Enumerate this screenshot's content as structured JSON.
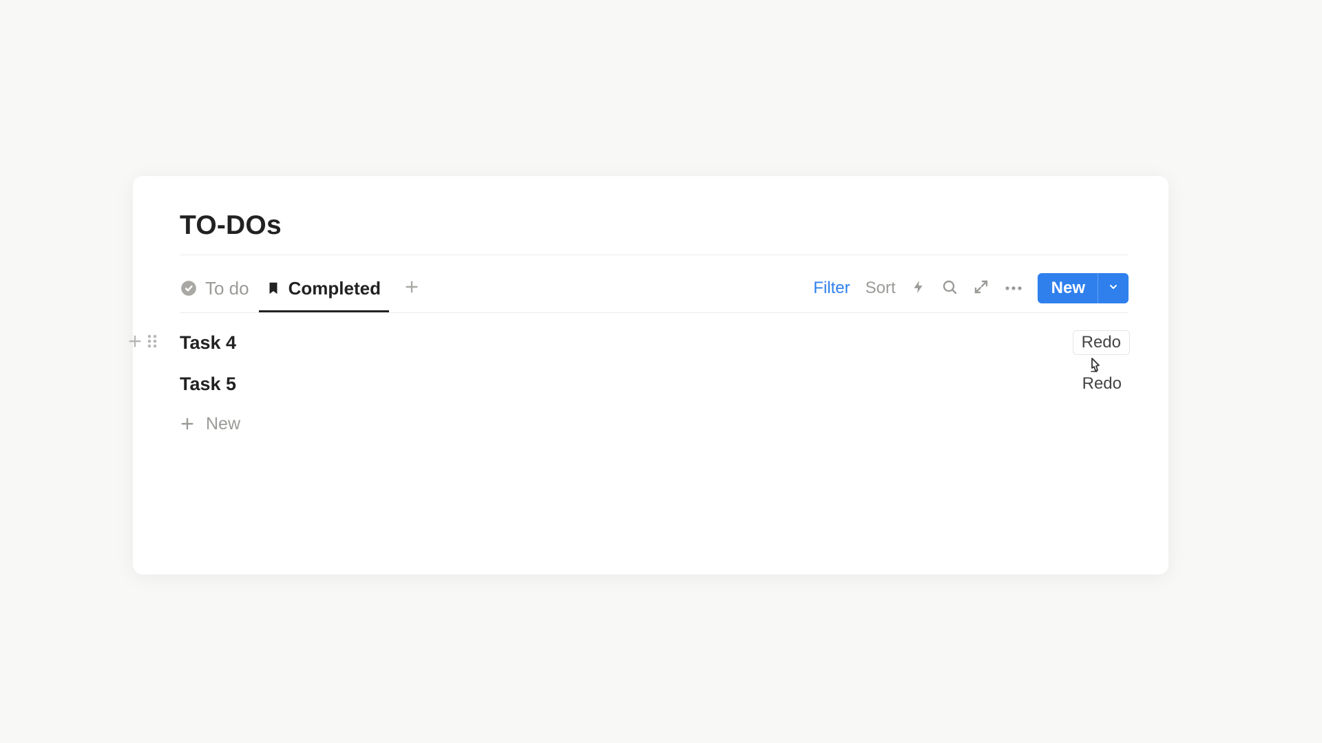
{
  "header": {
    "title": "TO-DOs"
  },
  "tabs": [
    {
      "label": "To do",
      "icon": "check-circle-icon",
      "active": false
    },
    {
      "label": "Completed",
      "icon": "bookmark-icon",
      "active": true
    }
  ],
  "toolbar": {
    "filter_label": "Filter",
    "sort_label": "Sort",
    "new_label": "New"
  },
  "tasks": [
    {
      "title": "Task 4",
      "action_label": "Redo",
      "hovered": true
    },
    {
      "title": "Task 5",
      "action_label": "Redo",
      "hovered": false
    }
  ],
  "new_row": {
    "label": "New"
  },
  "colors": {
    "accent": "#2f80ed"
  }
}
